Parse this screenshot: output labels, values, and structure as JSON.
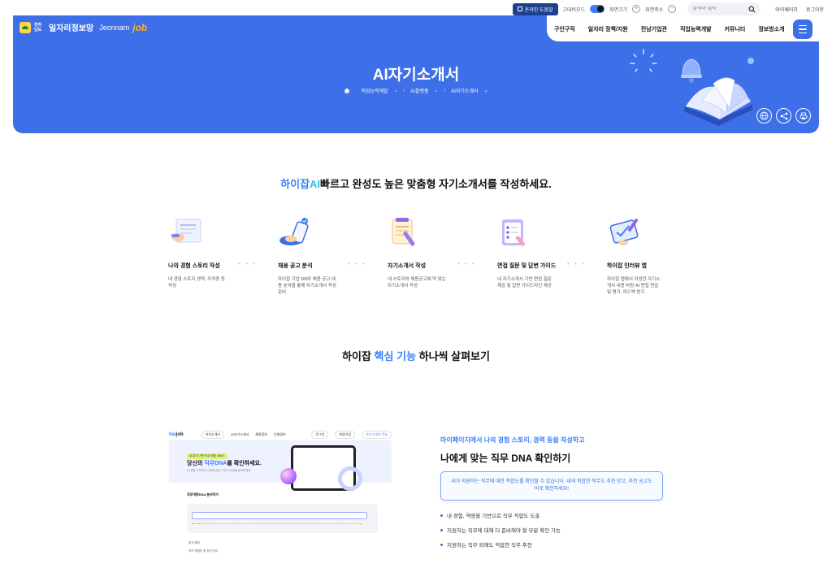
{
  "utility": {
    "help_label": "온라인 도움말",
    "mode_label": "고대비모드",
    "zoom_in_label": "화면크기",
    "zoom_out_label": "화면축소",
    "search_placeholder": "검색어 입력",
    "mypage_label": "마이페이지",
    "logout_label": "로그아웃"
  },
  "brand": {
    "province": "전라남도",
    "name": "일자리정보망",
    "english": "Jeonnam",
    "job": "job"
  },
  "gnb": [
    "구인구직",
    "일자리 정책/지원",
    "전남기업관",
    "직업능력개발",
    "커뮤니티",
    "정보방소개"
  ],
  "hero": {
    "title": "AI자기소개서",
    "breadcrumb": [
      "직업능력개발",
      "AI플랫폼",
      "AI자기소개서"
    ],
    "tools": {
      "lang": "Korean"
    }
  },
  "intro": {
    "hl1": "하이잡",
    "hl2": "AI",
    "text": "빠르고 완성도 높은 맞춤형 자기소개서를 작성하세요."
  },
  "steps": [
    {
      "title": "나의 경험 스토리 작성",
      "desc": "내 경험 스토리 경력, 자격증 등 작성"
    },
    {
      "title": "채용 공고 분석",
      "desc": "하이잡 기업 DB와 채용 공고 내용 분석을 통해 자기소개서 작성 준비"
    },
    {
      "title": "자기소개서 작성",
      "desc": "내 스토리와 채용공고에 딱 맞는 자기소개서 작성"
    },
    {
      "title": "면접 질문 및 답변 가이드",
      "desc": "내 자기소개서 기반 면접 질문 제공 및 답변 가이드라인 제공"
    },
    {
      "title": "하이잡 인터뷰 앱",
      "desc": "하이잡 앱에서 작성한 자기소개서 내용 바탕 AI 면접 연습 및 평가, 피드백 받기"
    }
  ],
  "section2": {
    "pre": "하이잡",
    "hl": "핵심 기능",
    "post": "하나씩 살펴보기"
  },
  "mockup": {
    "brand_pre": "hai",
    "brand_post": "job",
    "nav": [
      "자기소개서",
      "AI자기소개서",
      "채용정보",
      "인재정보"
    ],
    "pills": [
      "로그인",
      "회원가입",
      "자기소개서 작성"
    ],
    "badge": "AI 분석 기반 직무 매칭 서비스",
    "head_pre": "당신의",
    "head_hl": "직무DNA",
    "head_post": "를 확인하세요.",
    "sub": "내 경험 스토리로 나에게 맞는 직무 DNA를 찾아보세요",
    "section": "직무역량DNA 분석하기",
    "foot": [
      "분석 결과",
      "직무 적합도 및 추천 직무"
    ]
  },
  "feature": {
    "kicker": "마이페이지에서 나의 경험 스토리, 경력 등을 작성하고",
    "title": "나에게 맞는 직무 DNA 확인하기",
    "box": "내가 지원하는 직무에 대한 적합도를 확인할 수 있습니다. 내게 적합한 직무도 추천 받고, 추천 공고도 바로 확인하세요!",
    "bullets": [
      "내 경험, 역량을 기반으로 직무 적합도 도출",
      "지원하는 직무에 대해 더 준비해야 할 부분 확인 가능",
      "지원하는 직무 외에도 적합한 직무 추천"
    ]
  },
  "colors": {
    "brand_blue": "#3d6fe8",
    "accent_cyan": "#2ec4e6",
    "navy": "#1d3f8f"
  }
}
